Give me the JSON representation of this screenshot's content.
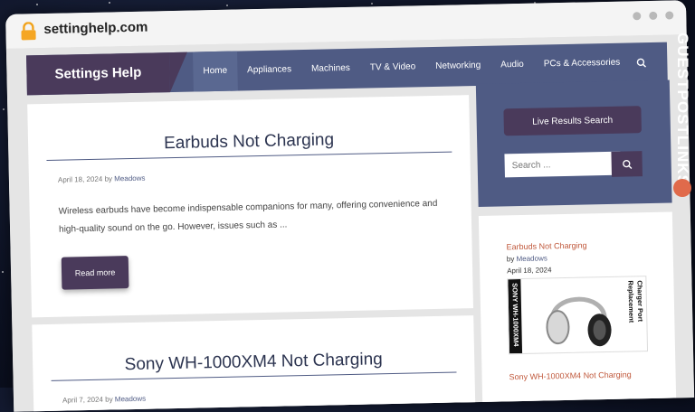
{
  "browser": {
    "url": "settinghelp.com"
  },
  "site": {
    "logo": "Settings Help",
    "nav": [
      "Home",
      "Appliances",
      "Machines",
      "TV & Video",
      "Networking",
      "Audio",
      "PCs & Accessories"
    ],
    "active_nav": "Home"
  },
  "posts": [
    {
      "title": "Earbuds Not Charging",
      "date": "April 18, 2024",
      "by": "by",
      "author": "Meadows",
      "excerpt": "Wireless earbuds have become indispensable companions for many, offering convenience and high-quality sound on the go. However, issues such as ...",
      "read_more": "Read more"
    },
    {
      "title": "Sony WH-1000XM4 Not Charging",
      "date": "April 7, 2024",
      "by": "by",
      "author": "Meadows"
    }
  ],
  "sidebar": {
    "live_search": "Live Results Search",
    "search_placeholder": "Search ...",
    "recent": [
      {
        "title": "Earbuds Not Charging",
        "by": "by",
        "author": "Meadows",
        "date": "April 18, 2024"
      },
      {
        "title": "Sony WH-1000XM4 Not Charging"
      }
    ],
    "thumbnail": {
      "left_text": "SONY WH-1000XM4",
      "right_text_1": "Charger Port",
      "right_text_2": "Replacement"
    }
  },
  "overlay_brand": "GUESTPOSTLINKS",
  "colors": {
    "header": "#4f5b84",
    "logo_bg": "#4a3a5b",
    "link": "#c0583b",
    "brand_icon": "#e06a4b"
  }
}
